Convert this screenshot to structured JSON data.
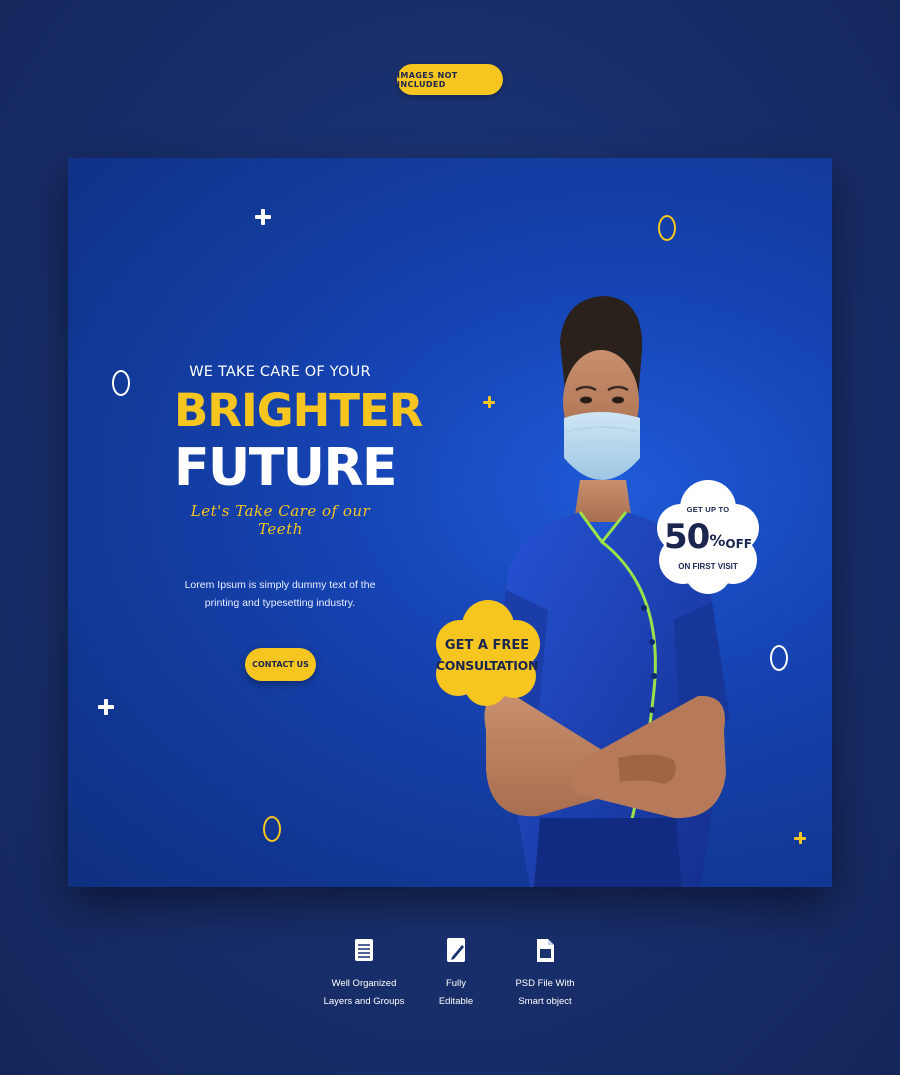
{
  "badge": {
    "label": "IMAGES NOT INCLUDED"
  },
  "banner": {
    "headline_small": "WE TAKE CARE OF YOUR",
    "headline_yellow": "BRIGHTER",
    "headline_white": "FUTURE",
    "script_line": "Let's Take Care of our Teeth",
    "body_text": "Lorem Ipsum is simply dummy text of the printing and typesetting industry.",
    "cta_label": "CONTACT US",
    "offer": {
      "line1": "GET UP TO",
      "amount": "50",
      "percent": "%",
      "off": "OFF",
      "line3": "ON FIRST VISIT"
    },
    "consultation": {
      "line1": "GET A FREE",
      "line2": "CONSULTATION"
    }
  },
  "features": [
    {
      "icon": "layers-icon",
      "label": "Well Organized\nLayers and Groups"
    },
    {
      "icon": "edit-icon",
      "label": "Fully\nEditable"
    },
    {
      "icon": "file-icon",
      "label": "PSD File With\nSmart object"
    }
  ],
  "colors": {
    "background": "#1a3270",
    "banner_blue": "#1644b4",
    "accent_yellow": "#f7c51f",
    "text_dark": "#1a2550",
    "scrub_blue": "#1c3fae",
    "piping_green": "#9be24a"
  }
}
